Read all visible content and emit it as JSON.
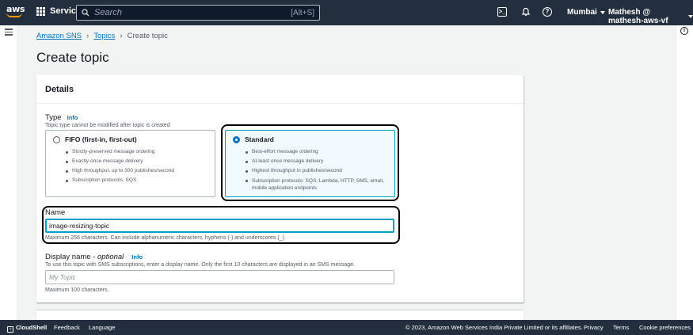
{
  "topnav": {
    "logo_text": "aws",
    "services_label": "Services",
    "search_placeholder": "Search",
    "search_shortcut": "[Alt+S]",
    "region": "Mumbai",
    "account": "Mathesh @ mathesh-aws-vf"
  },
  "breadcrumb": {
    "items": [
      "Amazon SNS",
      "Topics"
    ],
    "current": "Create topic"
  },
  "page": {
    "title": "Create topic"
  },
  "details": {
    "heading": "Details",
    "type_label": "Type",
    "info_label": "Info",
    "type_description": "Topic type cannot be modified after topic is created",
    "options": [
      {
        "title": "FIFO (first-in, first-out)",
        "selected": false,
        "bullets": [
          "Strictly-preserved message ordering",
          "Exactly-once message delivery",
          "High throughput, up to 300 publishes/second",
          "Subscription protocols: SQS"
        ]
      },
      {
        "title": "Standard",
        "selected": true,
        "bullets": [
          "Best-effort message ordering",
          "At-least once message delivery",
          "Highest throughput in publishes/second",
          "Subscription protocols: SQS, Lambda, HTTP, SMS, email, mobile application endpoints"
        ]
      }
    ],
    "name_label": "Name",
    "name_value": "image-resizing-topic",
    "name_hint": "Maximum 256 characters. Can include alphanumeric characters, hyphens (-) and underscores (_).",
    "display_name_label": "Display name - ",
    "display_name_optional": "optional",
    "display_name_info": "Info",
    "display_name_description": "To use this topic with SMS subscriptions, enter a display name. Only the first 10 characters are displayed in an SMS message.",
    "display_name_placeholder": "My Topic",
    "display_name_hint": "Maximum 100 characters."
  },
  "footer": {
    "cloudshell": "CloudShell",
    "feedback": "Feedback",
    "language": "Language",
    "copyright": "© 2023, Amazon Web Services India Private Limited or its affiliates.",
    "privacy": "Privacy",
    "terms": "Terms",
    "cookie": "Cookie preferences"
  },
  "colors": {
    "nav_bg": "#232f3e",
    "link": "#0073bb",
    "accent": "#ff9900",
    "selected_border": "#00a1c9"
  }
}
